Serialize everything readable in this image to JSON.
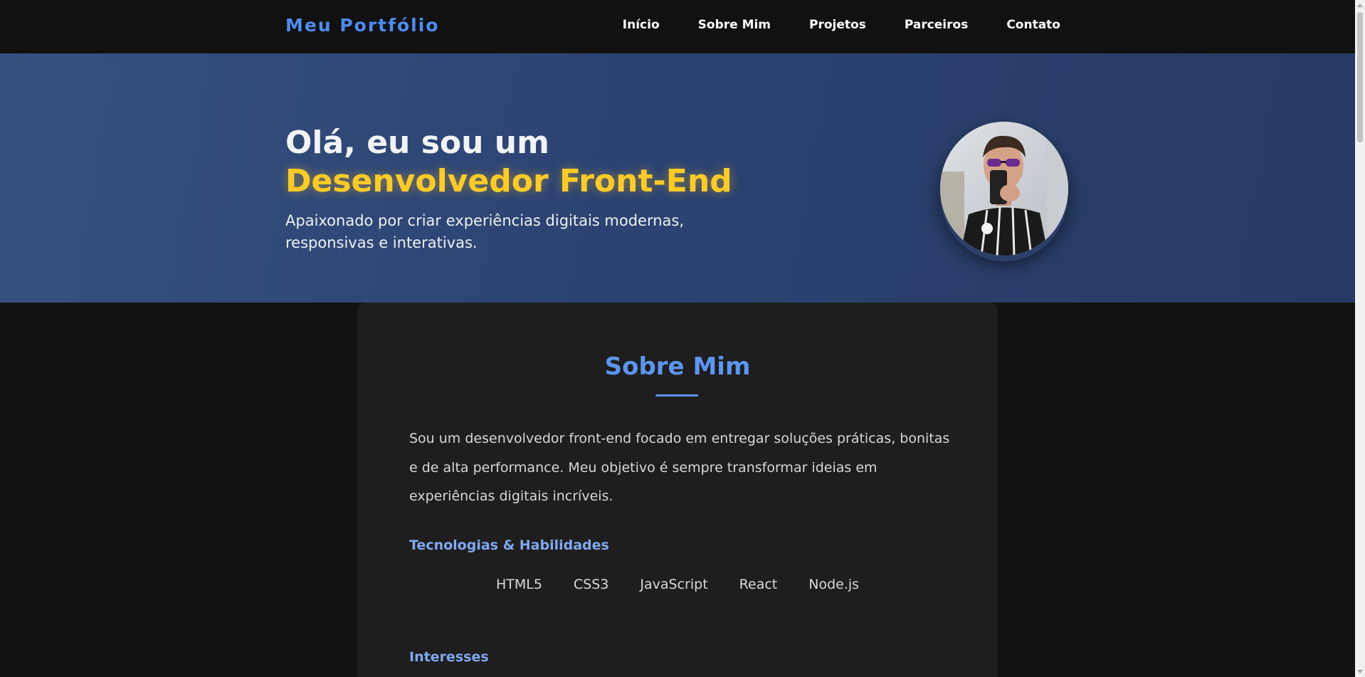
{
  "header": {
    "brand": "Meu Portfólio",
    "nav": [
      "Início",
      "Sobre Mim",
      "Projetos",
      "Parceiros",
      "Contato"
    ]
  },
  "hero": {
    "title_line1": "Olá, eu sou um",
    "title_line2": "Desenvolvedor Front-End",
    "subtitle": "Apaixonado por criar experiências digitais modernas, responsivas e interativas."
  },
  "about": {
    "title": "Sobre Mim",
    "text": "Sou um desenvolvedor front-end focado em entregar soluções práticas, bonitas e de alta performance. Meu objetivo é sempre transformar ideias em experiências digitais incríveis.",
    "skills_heading": "Tecnologias & Habilidades",
    "skills": [
      "HTML5",
      "CSS3",
      "JavaScript",
      "React",
      "Node.js"
    ],
    "interests_heading": "Interesses"
  },
  "colors": {
    "brand": "#4f8cf0",
    "accent_yellow": "#ffcb24",
    "hero_gradient_start": "#35507f",
    "hero_gradient_end": "#273a63",
    "section_title": "#5d96f2",
    "background": "#121212",
    "card": "#1e1e1e"
  },
  "icons": {
    "avatar": "profile-photo-icon"
  }
}
